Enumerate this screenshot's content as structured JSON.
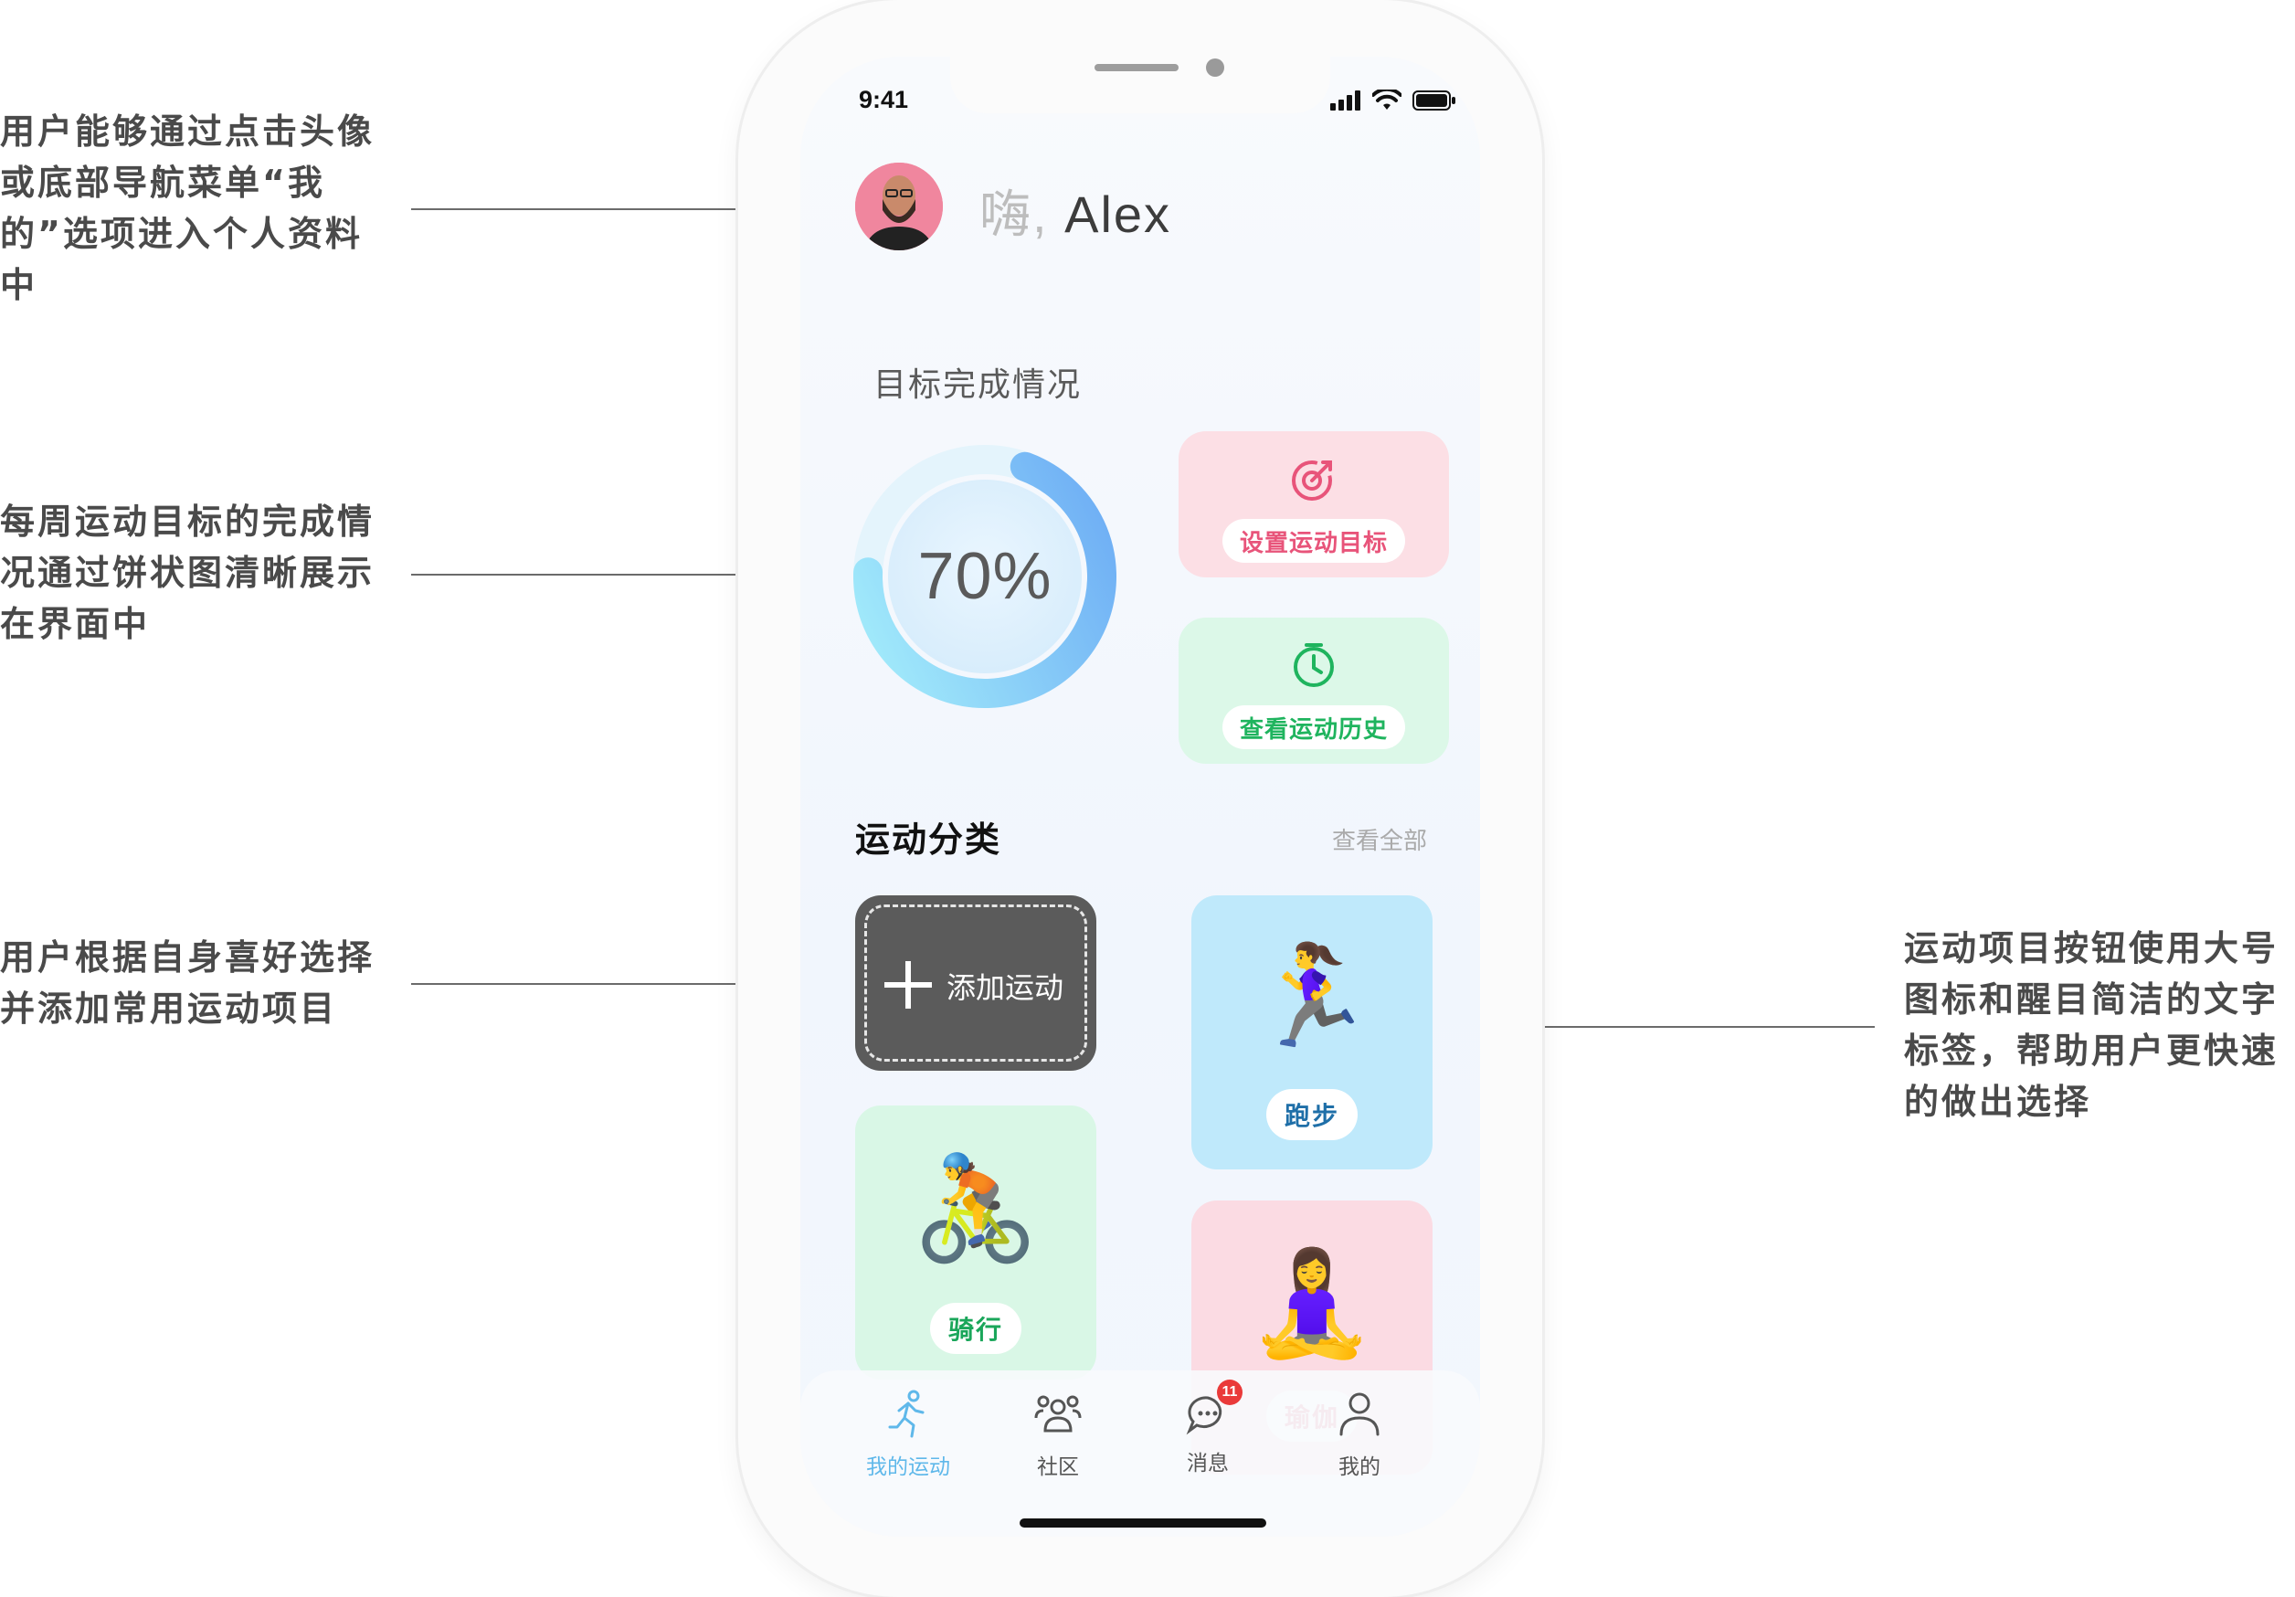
{
  "annotations": {
    "profile": [
      "用户能够通过点击头像",
      "或底部导航菜单“我",
      "的”选项进入个人资料",
      "中"
    ],
    "goal": [
      "每周运动目标的完成情",
      "况通过饼状图清晰展示",
      "在界面中"
    ],
    "add": [
      "用户根据自身喜好选择",
      "并添加常用运动项目"
    ],
    "buttons": [
      "运动项目按钮使用大号",
      "图标和醒目简洁的文字",
      "标签，帮助用户更快速",
      "的做出选择"
    ]
  },
  "status_bar": {
    "time": "9:41"
  },
  "header": {
    "greeting_hi": "嗨,",
    "greeting_name": " Alex"
  },
  "goal": {
    "title": "目标完成情况",
    "progress_label": "70%",
    "progress": 0.7,
    "set_goal_label": "设置运动目标",
    "history_label": "查看运动历史"
  },
  "categories": {
    "title": "运动分类",
    "see_all": "查看全部",
    "add_label": "添加运动",
    "items": [
      {
        "label": "跑步",
        "emoji": "🏃‍♀️",
        "bg": "#bfe9fb",
        "text_color": "#1f6fa8"
      },
      {
        "label": "骑行",
        "emoji": "🚴",
        "bg": "#d9f7e6",
        "text_color": "#1aa65a"
      },
      {
        "label": "瑜伽",
        "emoji": "🧘‍♀️",
        "bg": "#fbdbe3",
        "text_color": "#e07a94"
      }
    ]
  },
  "tabbar": {
    "items": [
      {
        "label": "我的运动",
        "icon": "running-icon",
        "active": true
      },
      {
        "label": "社区",
        "icon": "community-icon",
        "active": false
      },
      {
        "label": "消息",
        "icon": "message-icon",
        "active": false,
        "badge": "11"
      },
      {
        "label": "我的",
        "icon": "user-icon",
        "active": false
      }
    ]
  },
  "colors": {
    "accent_blue": "#5fb8ea",
    "pink_card": "#fcdfe5",
    "pink_text": "#e8547a",
    "green_card": "#dcf8e8",
    "green_text": "#1fb45e",
    "add_card": "#5b5b5b"
  }
}
